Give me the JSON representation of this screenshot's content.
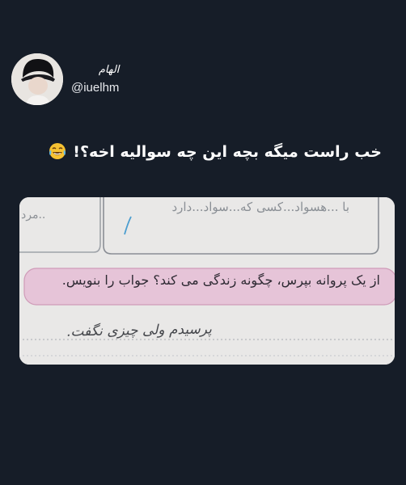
{
  "author": {
    "display_name": "الهام",
    "handle": "@iuelhm",
    "avatar_icon": "profile-avatar"
  },
  "tweet": {
    "text": "خب راست میگه بچه این چه سوالیه اخه؟!",
    "emoji_icon": "tears-of-joy-emoji"
  },
  "photo": {
    "top_line": "با ...هسواد...کسی که...سواد...دارد",
    "top_left": "..مرد",
    "question": "از یک پروانه بپرس، چگونه زندگی می کند؟ جواب را بنویس.",
    "handwritten_answer": "پرسیدم ولی چیزی نگفت."
  },
  "colors": {
    "background": "#161d28",
    "text": "#ffffff",
    "photo_paper": "#ecebea",
    "question_band": "#e2c7d8"
  }
}
